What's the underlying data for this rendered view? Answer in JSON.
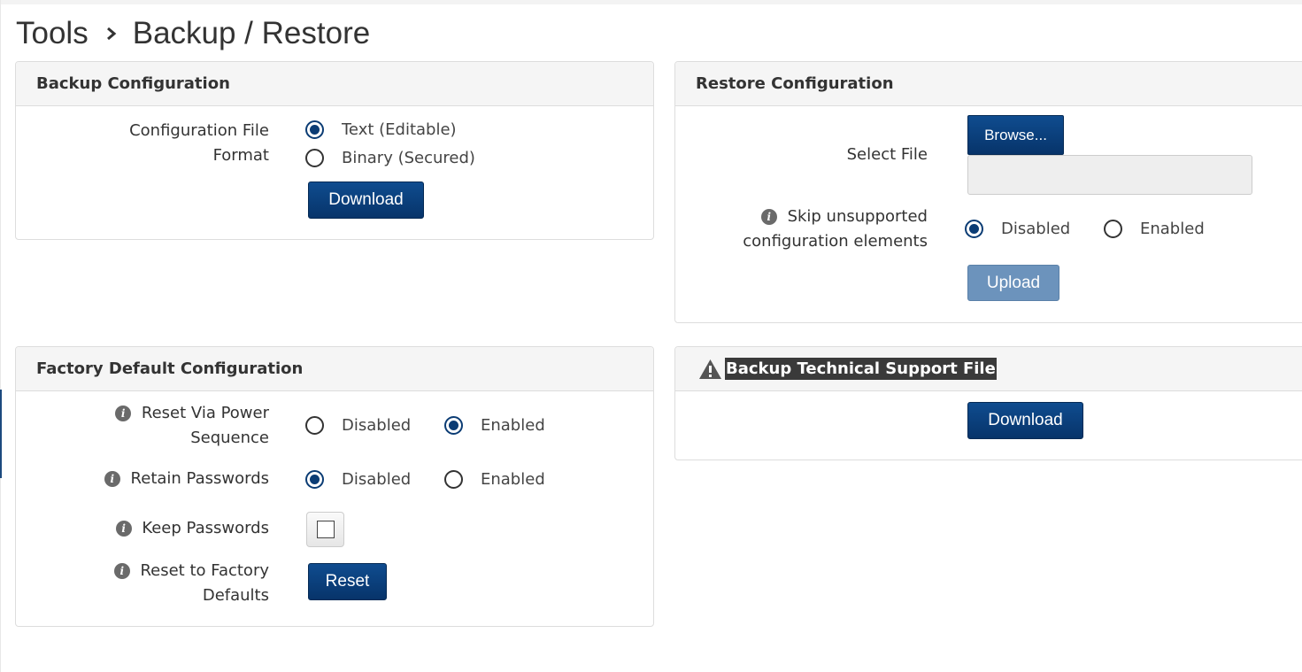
{
  "breadcrumb": {
    "root": "Tools",
    "current": "Backup / Restore"
  },
  "backup_config": {
    "title": "Backup Configuration",
    "format_label_line1": "Configuration File",
    "format_label_line2": "Format",
    "options": [
      {
        "label": "Text (Editable)",
        "checked": true
      },
      {
        "label": "Binary (Secured)",
        "checked": false
      }
    ],
    "download_label": "Download"
  },
  "restore_config": {
    "title": "Restore Configuration",
    "select_file_label": "Select File",
    "browse_label": "Browse...",
    "file_value": "",
    "skip_label_line1": "Skip unsupported",
    "skip_label_line2": "configuration elements",
    "skip_options": [
      {
        "label": "Disabled",
        "checked": true
      },
      {
        "label": "Enabled",
        "checked": false
      }
    ],
    "upload_label": "Upload"
  },
  "factory_default": {
    "title": "Factory Default Configuration",
    "reset_power_line1": "Reset Via Power",
    "reset_power_line2": "Sequence",
    "reset_power_options": [
      {
        "label": "Disabled",
        "checked": false
      },
      {
        "label": "Enabled",
        "checked": true
      }
    ],
    "retain_passwords_label": "Retain Passwords",
    "retain_passwords_options": [
      {
        "label": "Disabled",
        "checked": true
      },
      {
        "label": "Enabled",
        "checked": false
      }
    ],
    "keep_passwords_label": "Keep Passwords",
    "keep_passwords_checked": false,
    "reset_factory_line1": "Reset to Factory",
    "reset_factory_line2": "Defaults",
    "reset_label": "Reset"
  },
  "tech_support": {
    "title": "Backup Technical Support File",
    "download_label": "Download"
  },
  "icons": {
    "info": "info-icon",
    "warning": "warning-icon",
    "breadcrumb_separator": "chevron-right-icon"
  },
  "colors": {
    "primary_button": "#0b3c74",
    "disabled_button": "#6c93bc",
    "panel_header_bg": "#f5f5f5"
  }
}
